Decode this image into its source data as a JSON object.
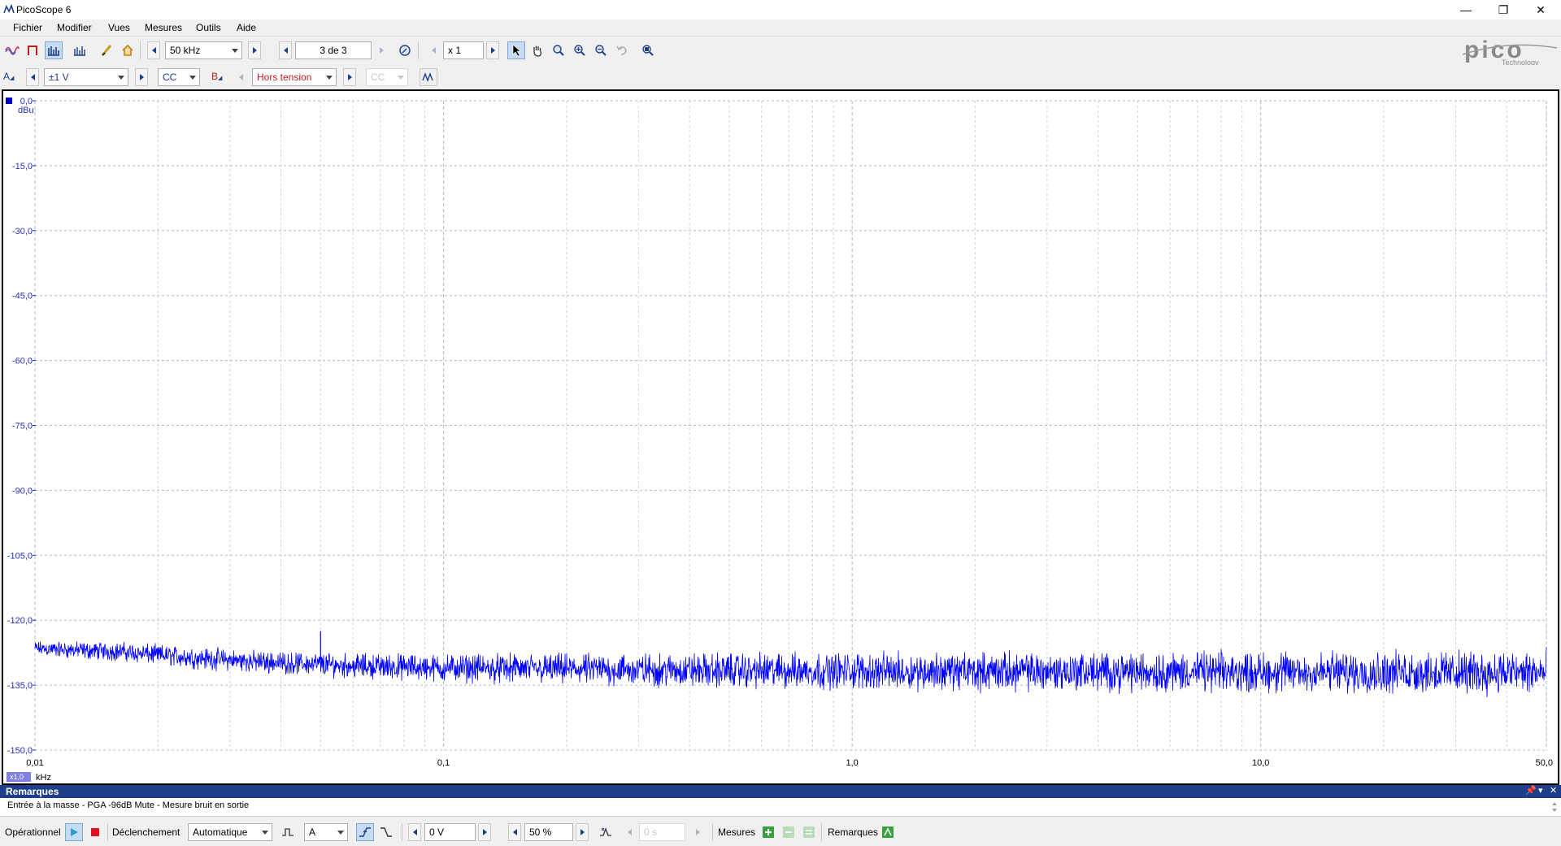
{
  "window": {
    "title": "PicoScope 6",
    "minimize": "—",
    "maximize": "❐",
    "close": "✕"
  },
  "menu": [
    "Fichier",
    "Modifier",
    "Vues",
    "Mesures",
    "Outils",
    "Aide"
  ],
  "toolbar1": {
    "sample_rate": "50 kHz",
    "buffer": "3 de 3",
    "zoom": "x 1"
  },
  "logo": {
    "word": "pico",
    "sub": "Technology"
  },
  "toolbar2": {
    "channel_a": "A",
    "range_a": "±1 V",
    "coupling_a": "CC",
    "channel_b": "B",
    "range_b": "Hors tension",
    "coupling_b": "CC"
  },
  "chart_data": {
    "type": "line",
    "x_scale": "log",
    "y_unit": "dBu",
    "x_unit": "kHz",
    "x_multiplier": "x1,0",
    "ylim": [
      -150,
      0
    ],
    "xlim": [
      0.01,
      50
    ],
    "y_ticks": [
      "0,0",
      "-15,0",
      "-30,0",
      "-45,0",
      "-60,0",
      "-75,0",
      "-90,0",
      "-105,0",
      "-120,0",
      "-135,0",
      "-150,0"
    ],
    "x_ticks": [
      "0,01",
      "0,1",
      "1,0",
      "10,0",
      "50,0"
    ],
    "grid": true,
    "series": [
      {
        "color": "#0000ff",
        "x": [
          0.01,
          0.013,
          0.016,
          0.02,
          0.025,
          0.03,
          0.035,
          0.04,
          0.045,
          0.05,
          0.06,
          0.08,
          0.1,
          0.15,
          0.2,
          0.3,
          0.5,
          1.0,
          2.0,
          5.0,
          10.0,
          20.0,
          50.0
        ],
        "y": [
          -126.5,
          -127.0,
          -127.2,
          -128.0,
          -128.7,
          -129.2,
          -129.6,
          -129.8,
          -130.0,
          -130.2,
          -130.5,
          -130.8,
          -131.0,
          -131.2,
          -131.3,
          -131.5,
          -131.6,
          -131.7,
          -131.8,
          -131.9,
          -132.0,
          -132.0,
          -132.1
        ],
        "spread": [
          2.0,
          2.4,
          2.6,
          2.8,
          3.0,
          3.0,
          3.0,
          3.0,
          3.0,
          3.2,
          3.4,
          3.6,
          3.8,
          4.0,
          4.2,
          4.5,
          4.8,
          5.0,
          5.2,
          5.4,
          5.6,
          5.8,
          6.0
        ],
        "peaks": [
          {
            "x": 0.05,
            "y": -122.5
          },
          {
            "x": 0.15,
            "y": -128.5
          }
        ]
      }
    ]
  },
  "remarks": {
    "title": "Remarques",
    "text": "Entrée à la masse - PGA -96dB Mute - Mesure bruit en sortie"
  },
  "statusbar": {
    "mode": "Opérationnel",
    "trigger_label": "Déclenchement",
    "trigger_mode": "Automatique",
    "trigger_source": "A",
    "threshold": "0 V",
    "pretrigger": "50 %",
    "delay": "0 s",
    "measures": "Mesures",
    "notes": "Remarques"
  }
}
